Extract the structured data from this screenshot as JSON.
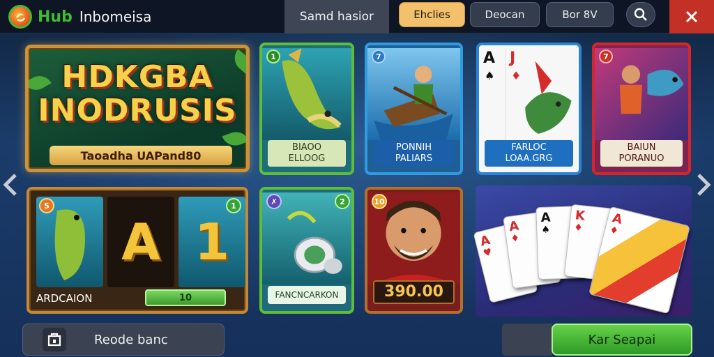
{
  "header": {
    "logo_hub": "Hub",
    "logo_name": "Inbomeisa",
    "search_tab": "Samd hasior",
    "nav": [
      "Ehclies",
      "Deocan",
      "Bor 8V"
    ],
    "active_nav": "Ehclies"
  },
  "hero": {
    "title": "HDKGBA\nINODRUSIS",
    "subtitle": "Taoadha UAPand80"
  },
  "cards_top": [
    {
      "badge": "1",
      "line1": "BIAOO",
      "line2": "ELLOOG"
    },
    {
      "badge": "7",
      "line1": "PONNIH",
      "line2": "PALIARS"
    },
    {
      "card_rank_a": "A",
      "card_rank_b": "J",
      "line1": "FARLOC",
      "line2": "LOAA.GRG"
    },
    {
      "badge": "7",
      "line1": "BAIUN",
      "line2": "PORANUO"
    }
  ],
  "slot": {
    "reel_letter_1": "A",
    "reel_letter_2": "1",
    "badge_left": "5",
    "badge_right": "1",
    "label": "ARDCAION",
    "bar_value": "10"
  },
  "cards_bottom": [
    {
      "badge_left": "✗",
      "badge_right": "2",
      "caption": "FANCNCARKON"
    },
    {
      "badge": "10",
      "caption": "390.00"
    }
  ],
  "playing_cards": [
    {
      "rank": "A",
      "suit": "♥"
    },
    {
      "rank": "A",
      "suit": "♦"
    },
    {
      "rank": "A",
      "suit": "♠"
    },
    {
      "rank": "K",
      "suit": "♦"
    },
    {
      "rank": "A",
      "suit": "♦"
    }
  ],
  "footer": {
    "left_label": "Reode banc",
    "cta_label": "Kar Seapai"
  },
  "colors": {
    "accent_gold": "#f3c06b",
    "close_red": "#c23026",
    "cta_green": "#3fb52f"
  }
}
